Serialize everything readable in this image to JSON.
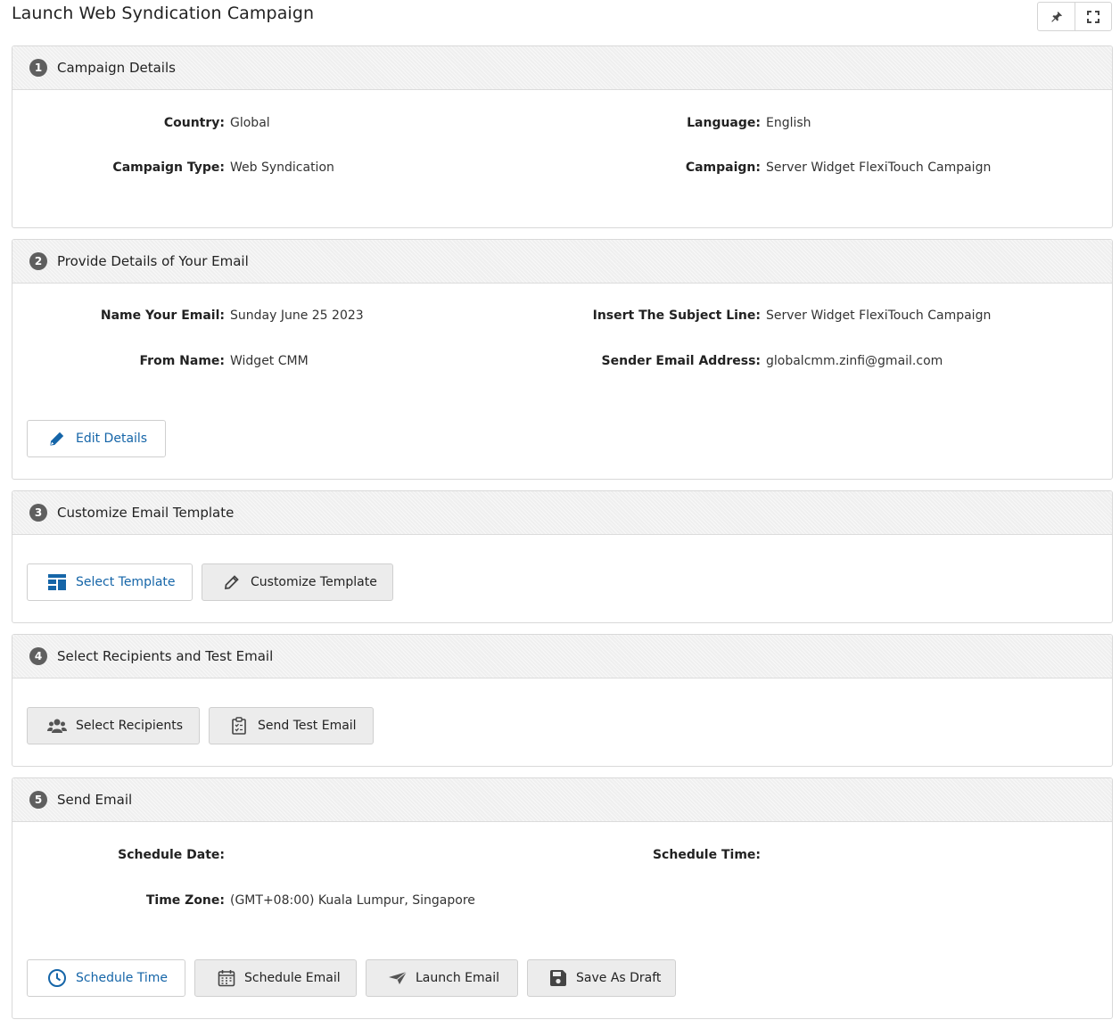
{
  "page": {
    "title": "Launch Web Syndication Campaign"
  },
  "toolbar": {
    "pin_icon": "pin-icon",
    "expand_icon": "fullscreen-icon"
  },
  "sections": {
    "campaign": {
      "number": "1",
      "title": "Campaign Details",
      "fields": {
        "country": {
          "label": "Country:",
          "value": "Global"
        },
        "language": {
          "label": "Language:",
          "value": "English"
        },
        "campaign_type": {
          "label": "Campaign Type:",
          "value": "Web Syndication"
        },
        "campaign": {
          "label": "Campaign:",
          "value": "Server Widget FlexiTouch Campaign"
        }
      }
    },
    "email": {
      "number": "2",
      "title": "Provide Details of Your Email",
      "fields": {
        "name": {
          "label": "Name Your Email:",
          "value": "Sunday June 25 2023"
        },
        "subject": {
          "label": "Insert The Subject Line:",
          "value": "Server Widget FlexiTouch Campaign"
        },
        "from": {
          "label": "From Name:",
          "value": "Widget CMM"
        },
        "sender": {
          "label": "Sender Email Address:",
          "value": "globalcmm.zinfi@gmail.com"
        }
      },
      "edit_button": "Edit Details"
    },
    "template": {
      "number": "3",
      "title": "Customize Email Template",
      "select_button": "Select Template",
      "customize_button": "Customize Template"
    },
    "recipients": {
      "number": "4",
      "title": "Select Recipients and Test Email",
      "select_button": "Select Recipients",
      "test_button": "Send Test Email"
    },
    "send": {
      "number": "5",
      "title": "Send Email",
      "fields": {
        "schedule_date": {
          "label": "Schedule Date:",
          "value": ""
        },
        "schedule_time": {
          "label": "Schedule Time:",
          "value": ""
        },
        "time_zone": {
          "label": "Time Zone:",
          "value": "(GMT+08:00) Kuala Lumpur, Singapore"
        }
      },
      "schedule_time_button": "Schedule Time",
      "schedule_email_button": "Schedule Email",
      "launch_button": "Launch Email",
      "draft_button": "Save As Draft"
    }
  },
  "colors": {
    "accent": "#1565a8",
    "header_bg": "#efefef",
    "step_badge": "#5f5f5f"
  }
}
